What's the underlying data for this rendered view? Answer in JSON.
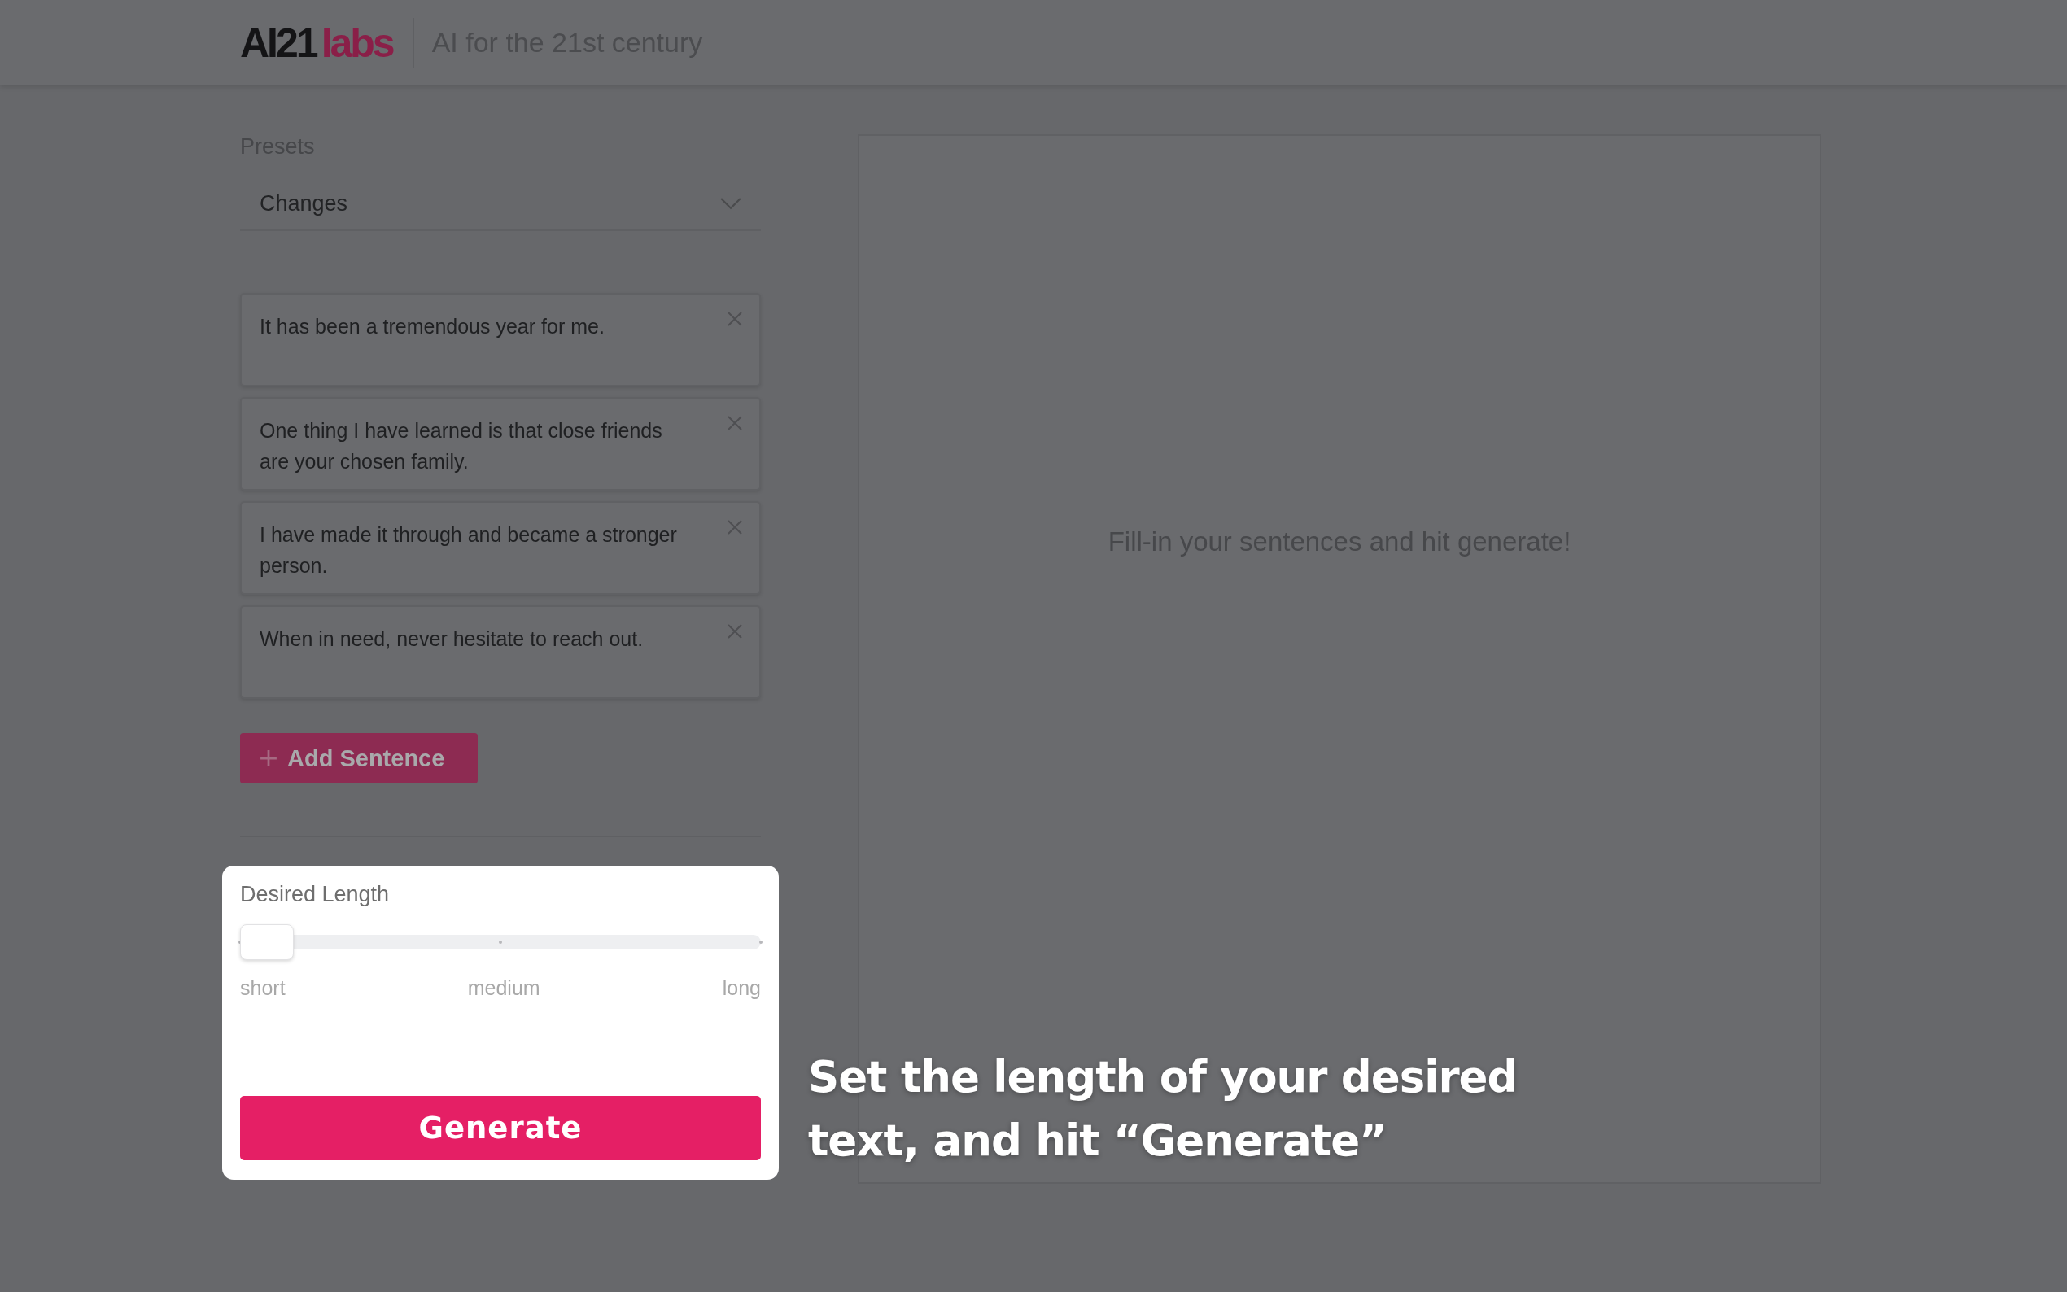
{
  "header": {
    "logo": {
      "part_1": "AI21",
      "part_2": "labs"
    },
    "tagline": "AI for the 21st century"
  },
  "presets": {
    "label": "Presets",
    "value": "Changes"
  },
  "sentences": [
    {
      "text": "It has been a tremendous year for me."
    },
    {
      "text": "One thing I have learned is that close friends are your chosen family."
    },
    {
      "text": "I have made it through and became a stronger person."
    },
    {
      "text": "When in need, never hesitate to reach out."
    }
  ],
  "add_button": {
    "label": "Add Sentence"
  },
  "length": {
    "label": "Desired Length",
    "level": 0,
    "stops": [
      "short",
      "medium",
      "long"
    ]
  },
  "generate_button": {
    "label": "Generate"
  },
  "output": {
    "empty_message": "Fill-in your sentences and hit generate!"
  },
  "caption": "Set the length of your desired text, and hit “Generate”"
}
